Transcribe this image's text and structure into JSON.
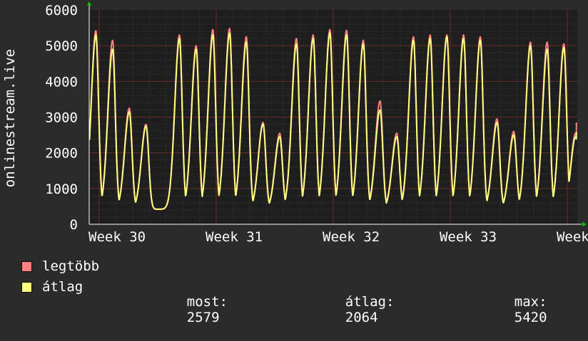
{
  "chart_data": {
    "type": "line",
    "ylabel": "onlinestream.live",
    "ylim": [
      0,
      6000
    ],
    "yticks": [
      0,
      1000,
      2000,
      3000,
      4000,
      5000,
      6000
    ],
    "xticks": [
      {
        "label": "Week 30",
        "day": 0
      },
      {
        "label": "Week 31",
        "day": 7
      },
      {
        "label": "Week 32",
        "day": 14
      },
      {
        "label": "Week 33",
        "day": 21
      },
      {
        "label": "Week 34",
        "day": 28
      }
    ],
    "xlim_days": [
      -0.6,
      28.6
    ],
    "grid": true,
    "colors": {
      "background": "#2b2b2b",
      "plot_background": "#1e1e1e",
      "grid_minor": "#3c3c3c",
      "grid_major": "#6a2b2b",
      "axis_arrow": "#00cc00",
      "max_series": "#ff8080",
      "avg_series": "#ffff80"
    },
    "series": [
      {
        "name": "legtöbb",
        "color": "#ff8080"
      },
      {
        "name": "átlag",
        "color": "#ffff80"
      }
    ],
    "daily_peaks": [
      {
        "day": -0.2,
        "max": 5420,
        "avg": 5300
      },
      {
        "day": 0.8,
        "max": 5150,
        "avg": 4900
      },
      {
        "day": 1.8,
        "max": 3250,
        "avg": 3150
      },
      {
        "day": 2.8,
        "max": 2800,
        "avg": 2750
      },
      {
        "day": 4.8,
        "max": 5300,
        "avg": 5200
      },
      {
        "day": 5.8,
        "max": 5000,
        "avg": 4900
      },
      {
        "day": 6.8,
        "max": 5450,
        "avg": 5300
      },
      {
        "day": 7.8,
        "max": 5480,
        "avg": 5350
      },
      {
        "day": 8.8,
        "max": 5250,
        "avg": 5100
      },
      {
        "day": 9.8,
        "max": 2850,
        "avg": 2800
      },
      {
        "day": 10.8,
        "max": 2550,
        "avg": 2450
      },
      {
        "day": 11.8,
        "max": 5200,
        "avg": 5050
      },
      {
        "day": 12.8,
        "max": 5300,
        "avg": 5200
      },
      {
        "day": 13.8,
        "max": 5450,
        "avg": 5350
      },
      {
        "day": 14.8,
        "max": 5430,
        "avg": 5300
      },
      {
        "day": 15.8,
        "max": 5150,
        "avg": 5050
      },
      {
        "day": 16.8,
        "max": 3450,
        "avg": 3200
      },
      {
        "day": 17.8,
        "max": 2550,
        "avg": 2450
      },
      {
        "day": 18.8,
        "max": 5250,
        "avg": 5150
      },
      {
        "day": 19.8,
        "max": 5300,
        "avg": 5200
      },
      {
        "day": 20.8,
        "max": 5300,
        "avg": 5250
      },
      {
        "day": 21.8,
        "max": 5300,
        "avg": 5200
      },
      {
        "day": 22.8,
        "max": 5250,
        "avg": 5150
      },
      {
        "day": 23.8,
        "max": 2950,
        "avg": 2850
      },
      {
        "day": 24.8,
        "max": 2600,
        "avg": 2500
      },
      {
        "day": 25.8,
        "max": 5100,
        "avg": 5000
      },
      {
        "day": 26.8,
        "max": 5100,
        "avg": 4900
      },
      {
        "day": 27.8,
        "max": 5050,
        "avg": 4950
      },
      {
        "day": 28.5,
        "max": 2550,
        "avg": 2450
      }
    ],
    "night_minimum": 420,
    "current": {
      "max": 2850,
      "avg": 2579
    }
  },
  "legend": {
    "max_label": "legtöbb",
    "avg_label": "átlag",
    "most_label": "most:",
    "most_value": "2579",
    "atlag_label": "átlag:",
    "atlag_value": "2064",
    "max_label_stat": "max:",
    "max_value": "5420"
  }
}
